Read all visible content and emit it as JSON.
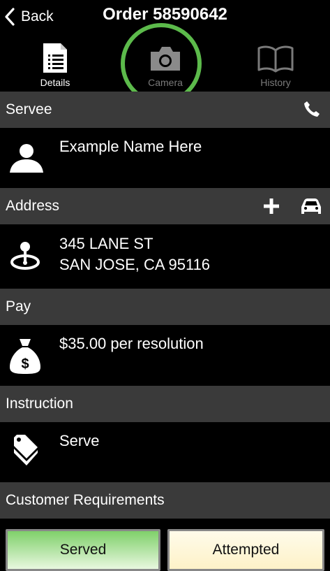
{
  "nav": {
    "back_label": "Back",
    "title": "Order 58590642"
  },
  "tabs": [
    {
      "label": "Details",
      "icon": "document-list-icon"
    },
    {
      "label": "Camera",
      "icon": "camera-icon"
    },
    {
      "label": "History",
      "icon": "open-book-icon"
    }
  ],
  "servee": {
    "header": "Servee",
    "name": "Example Name Here"
  },
  "address": {
    "header": "Address",
    "line1": "345 LANE ST",
    "line2": "SAN JOSE, CA 95116"
  },
  "pay": {
    "header": "Pay",
    "amount": "$35.00 per resolution"
  },
  "instruction": {
    "header": "Instruction",
    "text": "Serve"
  },
  "requirements": {
    "header": "Customer Requirements"
  },
  "actions": {
    "served_label": "Served",
    "attempted_label": "Attempted"
  },
  "colors": {
    "header_bg": "#3a3a3a",
    "highlight_ring": "#5cba4b",
    "served_gradient": [
      "#e8f7df",
      "#7fd06a"
    ],
    "attempted_gradient": [
      "#fdf6d6",
      "#fffbea"
    ]
  }
}
